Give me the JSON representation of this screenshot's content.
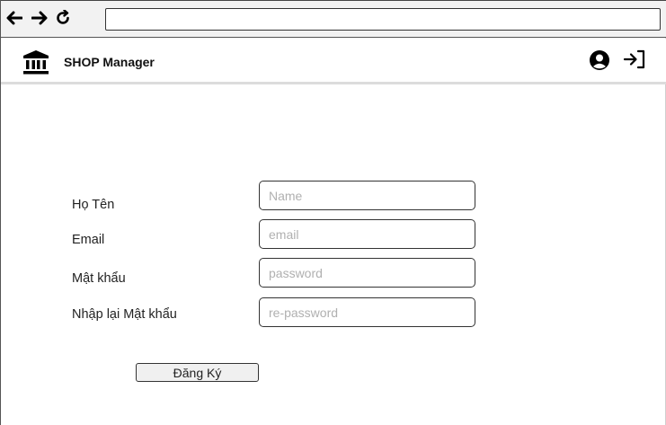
{
  "browser": {
    "url": "",
    "icons": [
      "back-arrow-icon",
      "forward-arrow-icon",
      "reload-icon"
    ]
  },
  "header": {
    "title": "SHOP Manager",
    "icons": [
      "bank-icon",
      "user-circle-icon",
      "logout-icon"
    ]
  },
  "form": {
    "fields": [
      {
        "label": "Họ Tên",
        "placeholder": "Name",
        "value": ""
      },
      {
        "label": "Email",
        "placeholder": "email",
        "value": ""
      },
      {
        "label": "Mật khẩu",
        "placeholder": "password",
        "value": ""
      },
      {
        "label": "Nhập lại Mật khẩu",
        "placeholder": "re-password",
        "value": ""
      }
    ],
    "submit_label": "Đăng Ký"
  }
}
